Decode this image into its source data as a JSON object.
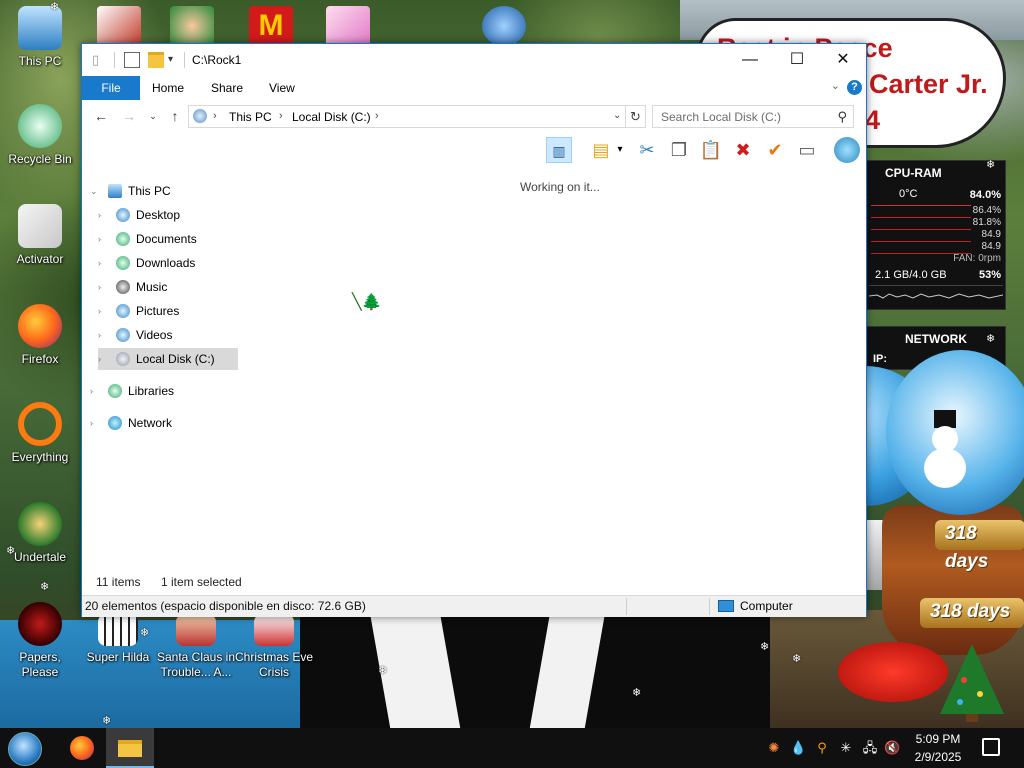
{
  "desktop": {
    "icons": [
      {
        "label": "This PC"
      },
      {
        "label": "Recycle Bin"
      },
      {
        "label": "Activator"
      },
      {
        "label": "Firefox"
      },
      {
        "label": "Everything"
      },
      {
        "label": "Undertale"
      },
      {
        "label": "Papers, Please"
      },
      {
        "label": "Super Hilda"
      },
      {
        "label": "Santa Claus in Trouble... A..."
      },
      {
        "label": "Christmas Eve Crisis"
      }
    ],
    "banner_lines": [
      "Rest in Peace",
      "Carter Jr.",
      "4"
    ]
  },
  "widgets": {
    "cpu": {
      "title": "CPU-RAM",
      "temp": "0°C",
      "total_pct": "84.0%",
      "cores": [
        "86.4%",
        "81.8%",
        "84.9",
        "84.9"
      ],
      "fan": "FAN: 0rpm",
      "ram": "2.1 GB/4.0 GB",
      "ram_pct": "53%"
    },
    "network": {
      "title": "NETWORK",
      "ip_label": "IP:"
    },
    "globe": {
      "days_text": "318 days",
      "small_num": "318"
    }
  },
  "window": {
    "title": "C:\\Rock1",
    "tabs": {
      "file": "File",
      "home": "Home",
      "share": "Share",
      "view": "View"
    },
    "address": {
      "segments": [
        "This PC",
        "Local Disk (C:)"
      ]
    },
    "search": {
      "placeholder": "Search Local Disk (C:)"
    },
    "nav": {
      "this_pc": "This PC",
      "items": [
        "Desktop",
        "Documents",
        "Downloads",
        "Music",
        "Pictures",
        "Videos",
        "Local Disk (C:)"
      ],
      "libraries": "Libraries",
      "network": "Network"
    },
    "content": {
      "status": "Working on it..."
    },
    "status": {
      "items_count": "11 items",
      "selected": "1 item selected",
      "detail": "20 elementos (espacio disponible en disco: 72.6 GB)",
      "location": "Computer"
    }
  },
  "taskbar": {
    "time": "5:09 PM",
    "date": "2/9/2025"
  }
}
